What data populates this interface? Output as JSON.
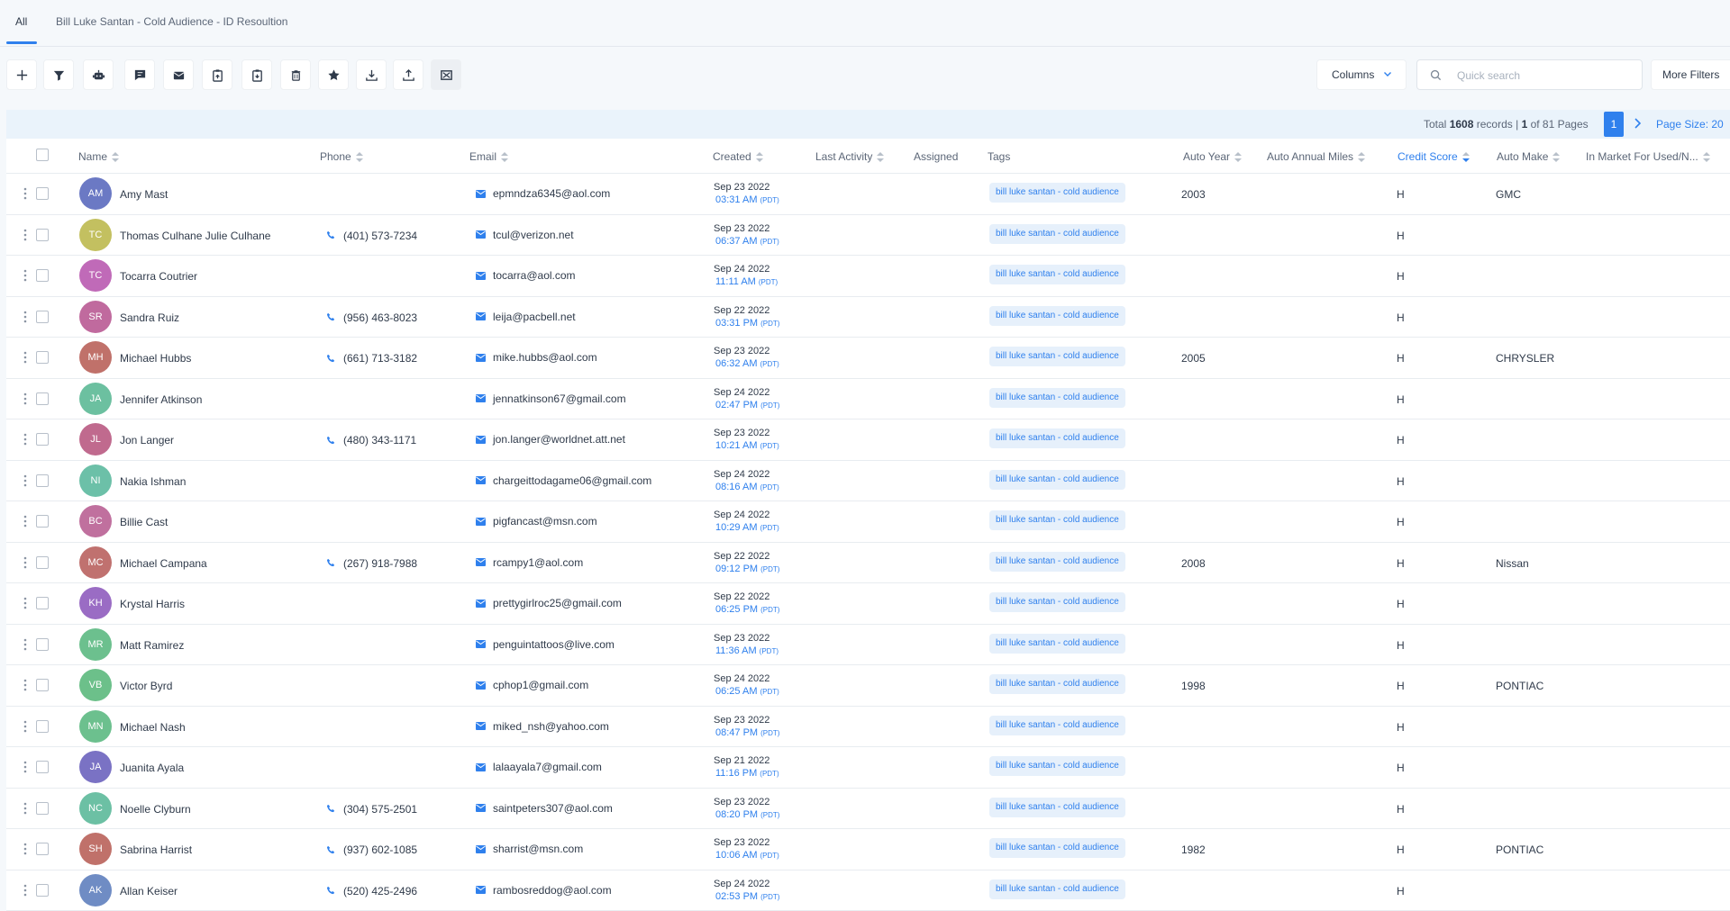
{
  "tabs": [
    {
      "label": "All"
    },
    {
      "label": "Bill Luke Santan - Cold Audience - ID Resoultion"
    }
  ],
  "toolbar": {
    "buttons": [
      "plus-icon",
      "filter-icon",
      "robot-icon",
      "message-icon",
      "envelope-icon",
      "clipboard-export-icon",
      "clipboard-import-icon",
      "trash-icon",
      "star-icon",
      "download-icon",
      "upload-icon",
      "merge-icon"
    ],
    "columns_label": "Columns",
    "search_placeholder": "Quick search",
    "more_filters_label": "More Filters"
  },
  "pagination": {
    "total_prefix": "Total",
    "total_records": "1608",
    "records_text": "records |",
    "current_page": "1",
    "of_pages_text": "of 81 Pages",
    "page_button": "1",
    "page_size_label": "Page Size: 20"
  },
  "columns": {
    "name": "Name",
    "phone": "Phone",
    "email": "Email",
    "created": "Created",
    "last_activity": "Last Activity",
    "assigned": "Assigned",
    "tags": "Tags",
    "auto_year": "Auto Year",
    "auto_annual_miles": "Auto Annual Miles",
    "credit_score": "Credit Score",
    "auto_make": "Auto Make",
    "in_market": "In Market For Used/N..."
  },
  "colors": {
    "accent": "#2f80ed"
  },
  "rows": [
    {
      "initials": "AM",
      "color": "#6b79c4",
      "name": "Amy Mast",
      "phone": "",
      "email": "epmndza6345@aol.com",
      "date": "Sep 23 2022",
      "time": "03:31 AM",
      "tz": "(PDT)",
      "tag": "bill luke santan - cold audience",
      "year": "2003",
      "credit": "H",
      "make": "GMC"
    },
    {
      "initials": "TC",
      "color": "#c3c060",
      "name": "Thomas Culhane Julie Culhane",
      "phone": "(401) 573-7234",
      "email": "tcul@verizon.net",
      "date": "Sep 23 2022",
      "time": "06:37 AM",
      "tz": "(PDT)",
      "tag": "bill luke santan - cold audience",
      "year": "",
      "credit": "H",
      "make": ""
    },
    {
      "initials": "TC",
      "color": "#c06ab8",
      "name": "Tocarra Coutrier",
      "phone": "",
      "email": "tocarra@aol.com",
      "date": "Sep 24 2022",
      "time": "11:11 AM",
      "tz": "(PDT)",
      "tag": "bill luke santan - cold audience",
      "year": "",
      "credit": "H",
      "make": ""
    },
    {
      "initials": "SR",
      "color": "#c06a9e",
      "name": "Sandra Ruiz",
      "phone": "(956) 463-8023",
      "email": "leija@pacbell.net",
      "date": "Sep 22 2022",
      "time": "03:31 PM",
      "tz": "(PDT)",
      "tag": "bill luke santan - cold audience",
      "year": "",
      "credit": "H",
      "make": ""
    },
    {
      "initials": "MH",
      "color": "#c0716a",
      "name": "Michael Hubbs",
      "phone": "(661) 713-3182",
      "email": "mike.hubbs@aol.com",
      "date": "Sep 23 2022",
      "time": "06:32 AM",
      "tz": "(PDT)",
      "tag": "bill luke santan - cold audience",
      "year": "2005",
      "credit": "H",
      "make": "CHRYSLER"
    },
    {
      "initials": "JA",
      "color": "#6cc0a0",
      "name": "Jennifer Atkinson",
      "phone": "",
      "email": "jennatkinson67@gmail.com",
      "date": "Sep 24 2022",
      "time": "02:47 PM",
      "tz": "(PDT)",
      "tag": "bill luke santan - cold audience",
      "year": "",
      "credit": "H",
      "make": ""
    },
    {
      "initials": "JL",
      "color": "#c06a8e",
      "name": "Jon Langer",
      "phone": "(480) 343-1171",
      "email": "jon.langer@worldnet.att.net",
      "date": "Sep 23 2022",
      "time": "10:21 AM",
      "tz": "(PDT)",
      "tag": "bill luke santan - cold audience",
      "year": "",
      "credit": "H",
      "make": ""
    },
    {
      "initials": "NI",
      "color": "#6cc0a8",
      "name": "Nakia Ishman",
      "phone": "",
      "email": "chargeittodagame06@gmail.com",
      "date": "Sep 24 2022",
      "time": "08:16 AM",
      "tz": "(PDT)",
      "tag": "bill luke santan - cold audience",
      "year": "",
      "credit": "H",
      "make": ""
    },
    {
      "initials": "BC",
      "color": "#c0709e",
      "name": "Billie Cast",
      "phone": "",
      "email": "pigfancast@msn.com",
      "date": "Sep 24 2022",
      "time": "10:29 AM",
      "tz": "(PDT)",
      "tag": "bill luke santan - cold audience",
      "year": "",
      "credit": "H",
      "make": ""
    },
    {
      "initials": "MC",
      "color": "#c0716f",
      "name": "Michael Campana",
      "phone": "(267) 918-7988",
      "email": "rcampy1@aol.com",
      "date": "Sep 22 2022",
      "time": "09:12 PM",
      "tz": "(PDT)",
      "tag": "bill luke santan - cold audience",
      "year": "2008",
      "credit": "H",
      "make": "Nissan"
    },
    {
      "initials": "KH",
      "color": "#9a6cc4",
      "name": "Krystal Harris",
      "phone": "",
      "email": "prettygirlroc25@gmail.com",
      "date": "Sep 22 2022",
      "time": "06:25 PM",
      "tz": "(PDT)",
      "tag": "bill luke santan - cold audience",
      "year": "",
      "credit": "H",
      "make": ""
    },
    {
      "initials": "MR",
      "color": "#6cc08e",
      "name": "Matt Ramirez",
      "phone": "",
      "email": "penguintattoos@live.com",
      "date": "Sep 23 2022",
      "time": "11:36 AM",
      "tz": "(PDT)",
      "tag": "bill luke santan - cold audience",
      "year": "",
      "credit": "H",
      "make": ""
    },
    {
      "initials": "VB",
      "color": "#6cc08a",
      "name": "Victor Byrd",
      "phone": "",
      "email": "cphop1@gmail.com",
      "date": "Sep 24 2022",
      "time": "06:25 AM",
      "tz": "(PDT)",
      "tag": "bill luke santan - cold audience",
      "year": "1998",
      "credit": "H",
      "make": "PONTIAC"
    },
    {
      "initials": "MN",
      "color": "#6cc08e",
      "name": "Michael Nash",
      "phone": "",
      "email": "miked_nsh@yahoo.com",
      "date": "Sep 23 2022",
      "time": "08:47 PM",
      "tz": "(PDT)",
      "tag": "bill luke santan - cold audience",
      "year": "",
      "credit": "H",
      "make": ""
    },
    {
      "initials": "JA",
      "color": "#7a72c4",
      "name": "Juanita Ayala",
      "phone": "",
      "email": "lalaayala7@gmail.com",
      "date": "Sep 21 2022",
      "time": "11:16 PM",
      "tz": "(PDT)",
      "tag": "bill luke santan - cold audience",
      "year": "",
      "credit": "H",
      "make": ""
    },
    {
      "initials": "NC",
      "color": "#6cc0a4",
      "name": "Noelle Clyburn",
      "phone": "(304) 575-2501",
      "email": "saintpeters307@aol.com",
      "date": "Sep 23 2022",
      "time": "08:20 PM",
      "tz": "(PDT)",
      "tag": "bill luke santan - cold audience",
      "year": "",
      "credit": "H",
      "make": ""
    },
    {
      "initials": "SH",
      "color": "#c0716a",
      "name": "Sabrina Harrist",
      "phone": "(937) 602-1085",
      "email": "sharrist@msn.com",
      "date": "Sep 23 2022",
      "time": "10:06 AM",
      "tz": "(PDT)",
      "tag": "bill luke santan - cold audience",
      "year": "1982",
      "credit": "H",
      "make": "PONTIAC"
    },
    {
      "initials": "AK",
      "color": "#6f8cc4",
      "name": "Allan Keiser",
      "phone": "(520) 425-2496",
      "email": "rambosreddog@aol.com",
      "date": "Sep 24 2022",
      "time": "02:53 PM",
      "tz": "(PDT)",
      "tag": "bill luke santan - cold audience",
      "year": "",
      "credit": "H",
      "make": ""
    }
  ]
}
